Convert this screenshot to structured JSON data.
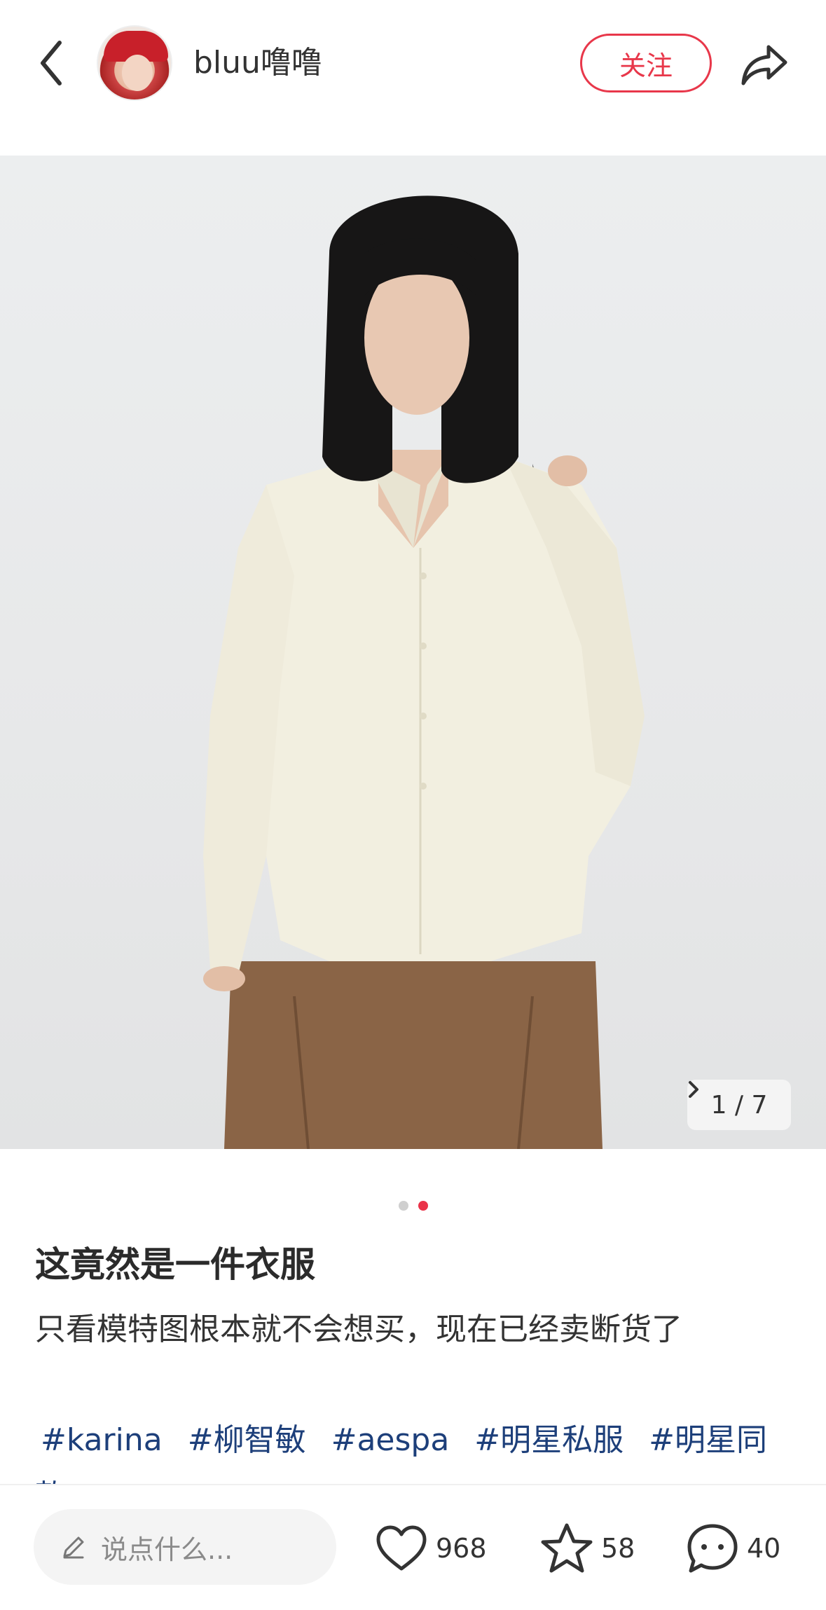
{
  "header": {
    "username": "bluu噜噜",
    "follow_label": "关注",
    "back_icon": "chevron-left-icon",
    "share_icon": "share-arrow-icon"
  },
  "image": {
    "counter_current": "1",
    "counter_total": "7",
    "counter_text": "1 / 7",
    "counter_icon": "chevron-right-icon",
    "dots_total": 2,
    "dots_active_index": 1
  },
  "post": {
    "title": "这竟然是一件衣服",
    "description": "只看模特图根本就不会想买，现在已经卖断货了",
    "tags": [
      "#karina",
      "#柳智敏",
      "#aespa",
      "#明星私服",
      "#明星同"
    ],
    "tag_overflow": "款"
  },
  "bottom_bar": {
    "comment_placeholder": "说点什么...",
    "likes": "968",
    "favorites": "58",
    "comments": "40"
  },
  "colors": {
    "accent": "#e8374a",
    "tag": "#1d3f7a",
    "dot_active": "#ea3349",
    "dot_inactive": "#cfcfcf"
  }
}
